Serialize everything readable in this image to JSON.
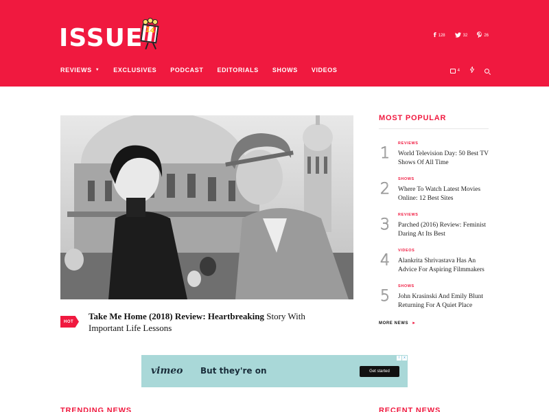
{
  "brand": {
    "logo_text": "ISSUE",
    "logo_number": "14",
    "accent_color": "#f0193f"
  },
  "social": [
    {
      "icon": "facebook-icon",
      "glyph": "f",
      "count": "128"
    },
    {
      "icon": "twitter-icon",
      "glyph": "t",
      "count": "32"
    },
    {
      "icon": "pinterest-icon",
      "glyph": "p",
      "count": "26"
    }
  ],
  "nav": {
    "items": [
      "REVIEWS",
      "EXCLUSIVES",
      "PODCAST",
      "EDITORIALS",
      "SHOWS",
      "VIDEOS"
    ],
    "cart_count": "4"
  },
  "hero": {
    "tag": "HOT",
    "headline_bold": "Take Me Home (2018) Review: Heartbreaking",
    "headline_rest": " Story With Important Life Lessons"
  },
  "ad": {
    "brand": "vimeo",
    "text": "But they're on",
    "button": "Get started",
    "info_glyph": "i",
    "close_glyph": "x"
  },
  "sidebar": {
    "title": "MOST POPULAR",
    "items": [
      {
        "num": "1",
        "category": "REVIEWS",
        "title": "World Television Day: 50 Best TV Shows Of All Time"
      },
      {
        "num": "2",
        "category": "SHOWS",
        "title": "Where To Watch Latest Movies Online: 12 Best Sites"
      },
      {
        "num": "3",
        "category": "REVIEWS",
        "title": "Parched (2016) Review: Feminist Daring At Its Best"
      },
      {
        "num": "4",
        "category": "VIDEOS",
        "title": "Alankrita Shrivastava Has An Advice For Aspiring Filmmakers"
      },
      {
        "num": "5",
        "category": "SHOWS",
        "title": "John Krasinski And Emily Blunt Returning For A Quiet Place"
      }
    ],
    "more_news": "MORE NEWS"
  },
  "sections": {
    "trending": "TRENDING NEWS",
    "recent": "RECENT NEWS"
  }
}
